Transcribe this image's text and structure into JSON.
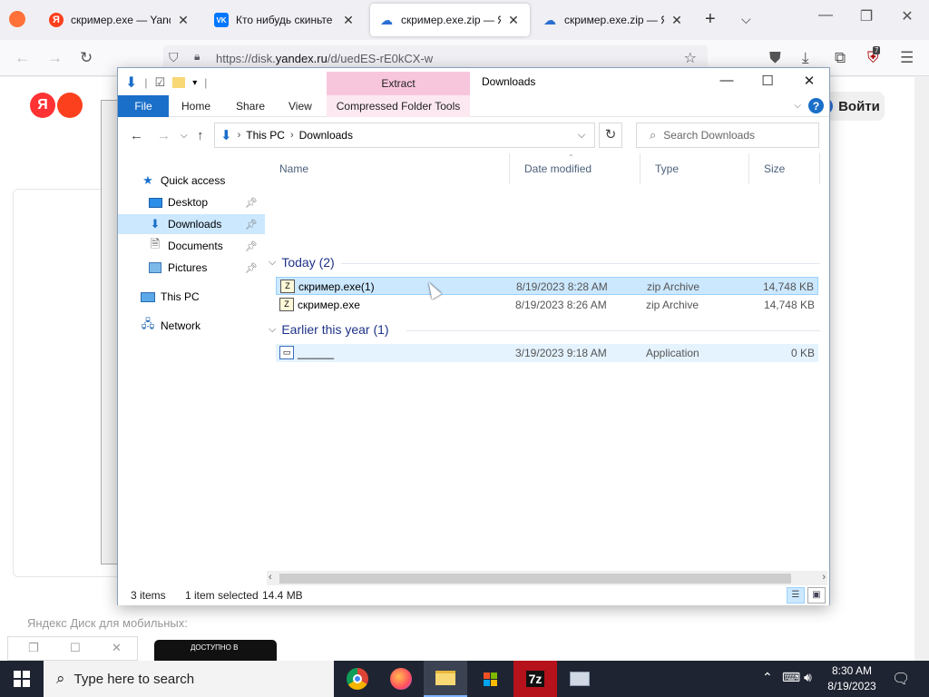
{
  "browser": {
    "tabs": [
      {
        "title": "скример.exe — Yande",
        "fav": "Я",
        "fav_color": "#fc3f1d"
      },
      {
        "title": "Кто нибудь скиньте ск",
        "fav": "VK",
        "fav_color": "#0077ff"
      },
      {
        "title": "скример.exe.zip — Ян",
        "fav": "☁",
        "fav_color": "#2a6fd1"
      },
      {
        "title": "скример.exe.zip — Ян",
        "fav": "☁",
        "fav_color": "#2a6fd1"
      }
    ],
    "url_host_prefix": "https://disk.",
    "url_host": "yandex.ru",
    "url_path": "/d/uedES-rE0kCX-w",
    "extension_badge": "7"
  },
  "yandex": {
    "logo": "Я",
    "login_label": "Войти",
    "login_icon": "?",
    "mobile_text": "Яндекс Диск для мобильных:",
    "google_play_label": "ДОСТУПНО В"
  },
  "explorer": {
    "title": "Downloads",
    "extract_label": "Extract",
    "ribbon_tabs": {
      "file": "File",
      "home": "Home",
      "share": "Share",
      "view": "View",
      "compressed": "Compressed Folder Tools"
    },
    "breadcrumb": [
      "This PC",
      "Downloads"
    ],
    "search_placeholder": "Search Downloads",
    "nav": {
      "quick_access": "Quick access",
      "desktop": "Desktop",
      "downloads": "Downloads",
      "documents": "Documents",
      "pictures": "Pictures",
      "this_pc": "This PC",
      "network": "Network"
    },
    "columns": {
      "name": "Name",
      "date": "Date modified",
      "type": "Type",
      "size": "Size"
    },
    "groups": [
      {
        "label": "Today (2)",
        "files": [
          {
            "name": "скример.exe(1)",
            "date": "8/19/2023 8:28 AM",
            "type": "zip Archive",
            "size": "14,748 KB"
          },
          {
            "name": "скример.exe",
            "date": "8/19/2023 8:26 AM",
            "type": "zip Archive",
            "size": "14,748 KB"
          }
        ]
      },
      {
        "label": "Earlier this year (1)",
        "files": [
          {
            "name": "______",
            "date": "3/19/2023 9:18 AM",
            "type": "Application",
            "size": "0 KB"
          }
        ]
      }
    ],
    "status": {
      "items": "3 items",
      "selected": "1 item selected",
      "size": "14.4 MB"
    }
  },
  "taskbar": {
    "search_placeholder": "Type here to search",
    "time": "8:30 AM",
    "date": "8/19/2023",
    "zip_label": "7z"
  }
}
